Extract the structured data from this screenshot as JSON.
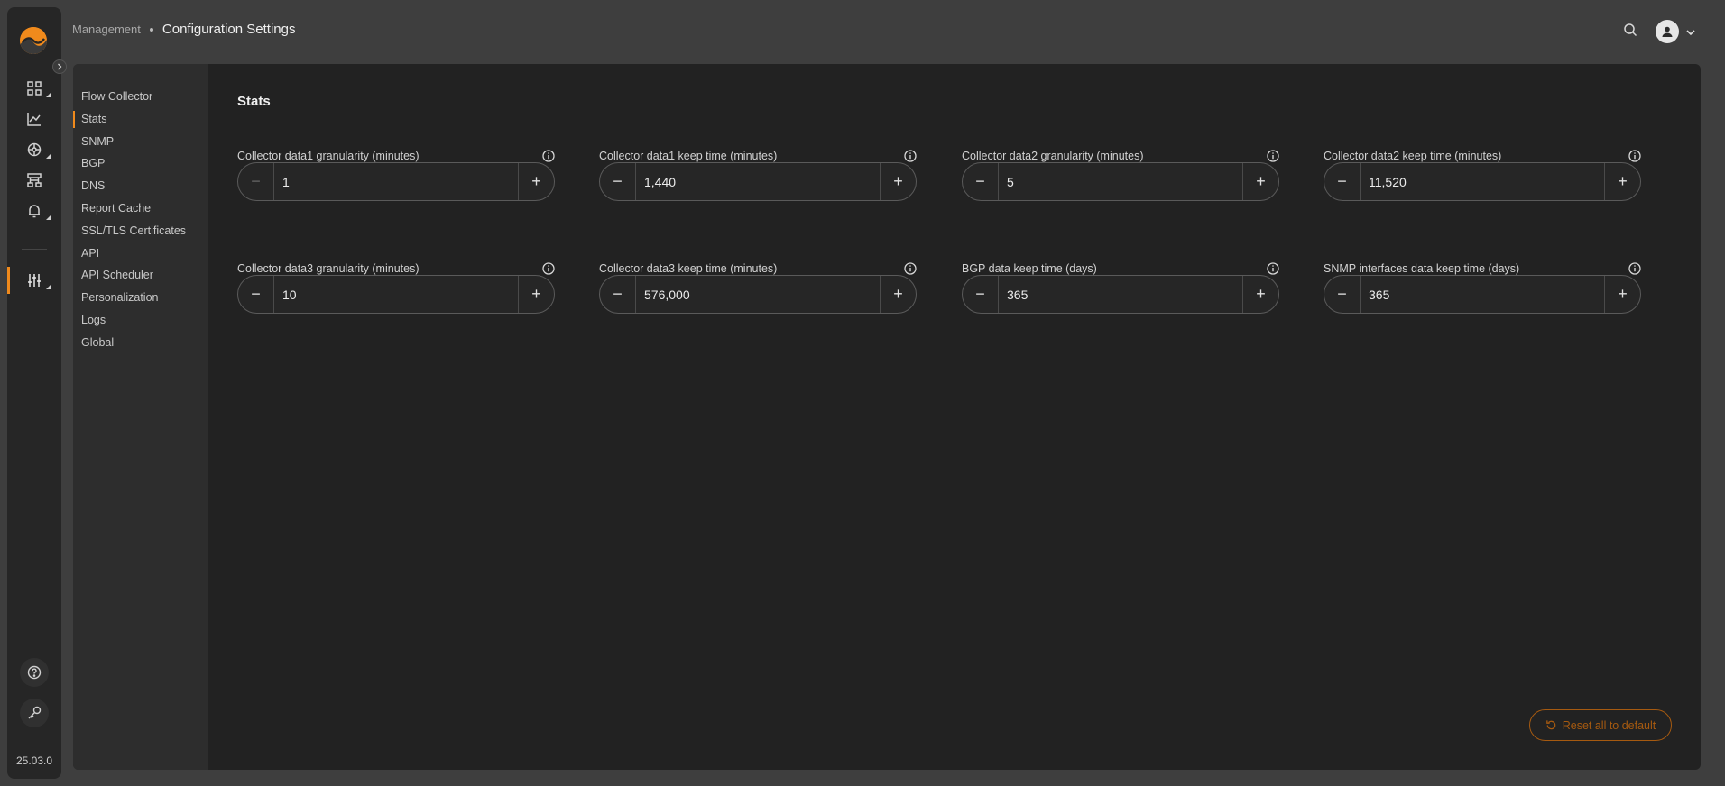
{
  "app": {
    "version": "25.03.0"
  },
  "breadcrumb": {
    "parent": "Management",
    "current": "Configuration Settings"
  },
  "rail": {
    "items": [
      "dashboard-icon",
      "chart-icon",
      "network-icon",
      "topology-icon",
      "bell-icon",
      "sliders-icon"
    ],
    "bottom": [
      "help-icon",
      "key-icon"
    ]
  },
  "subnav": {
    "items": [
      {
        "label": "Flow Collector"
      },
      {
        "label": "Stats",
        "active": true
      },
      {
        "label": "SNMP"
      },
      {
        "label": "BGP"
      },
      {
        "label": "DNS"
      },
      {
        "label": "Report Cache"
      },
      {
        "label": "SSL/TLS Certificates"
      },
      {
        "label": "API"
      },
      {
        "label": "API Scheduler"
      },
      {
        "label": "Personalization"
      },
      {
        "label": "Logs"
      },
      {
        "label": "Global"
      }
    ]
  },
  "section": {
    "title": "Stats"
  },
  "fields": [
    {
      "label": "Collector data1 granularity (minutes)",
      "value": "1"
    },
    {
      "label": "Collector data1 keep time (minutes)",
      "value": "1,440"
    },
    {
      "label": "Collector data2 granularity (minutes)",
      "value": "5"
    },
    {
      "label": "Collector data2 keep time (minutes)",
      "value": "11,520"
    },
    {
      "label": "Collector data3 granularity (minutes)",
      "value": "10"
    },
    {
      "label": "Collector data3 keep time (minutes)",
      "value": "576,000"
    },
    {
      "label": "BGP data keep time (days)",
      "value": "365"
    },
    {
      "label": "SNMP interfaces data keep time (days)",
      "value": "365"
    }
  ],
  "actions": {
    "reset_label": "Reset all to default"
  },
  "colors": {
    "accent": "#f08a1c",
    "panel": "#222222",
    "subnav": "#2d2d2d",
    "background": "#3e3e3e"
  }
}
